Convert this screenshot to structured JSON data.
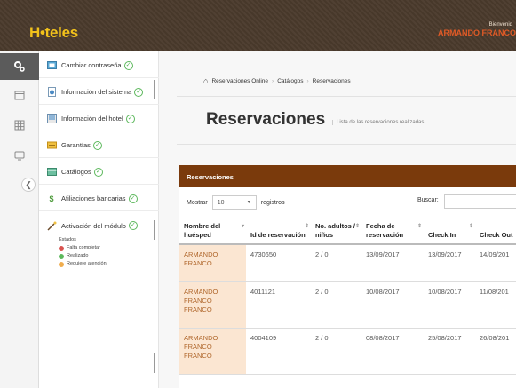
{
  "header": {
    "logo": "H•teles",
    "welcome_label": "Bienvenid",
    "user_name": "ARMANDO FRANCO"
  },
  "menu": {
    "items": [
      {
        "label": "Cambiar contraseña",
        "icon": "key-icon"
      },
      {
        "label": "Información del sistema",
        "icon": "info-icon"
      },
      {
        "label": "Información del hotel",
        "icon": "hotel-icon"
      },
      {
        "label": "Garantías",
        "icon": "garantia-icon"
      },
      {
        "label": "Catálogos",
        "icon": "catalog-icon"
      },
      {
        "label": "Afiliaciones bancarias",
        "icon": "dollar-icon"
      },
      {
        "label": "Activación del módulo",
        "icon": "wand-icon"
      }
    ],
    "legend": {
      "title": "Estados",
      "items": [
        {
          "label": "Falta completar",
          "color": "#d9534f"
        },
        {
          "label": "Realizado",
          "color": "#5cb85c"
        },
        {
          "label": "Requiere atención",
          "color": "#f0ad4e"
        }
      ]
    }
  },
  "breadcrumb": {
    "items": [
      "Reservaciones Online",
      "Catálogos",
      "Reservaciones"
    ]
  },
  "page": {
    "title": "Reservaciones",
    "subtitle": "Lista de las reservaciones realizadas."
  },
  "panel": {
    "title": "Reservaciones",
    "show_label": "Mostrar",
    "show_value": "10",
    "records_label": "registros",
    "search_label": "Buscar:"
  },
  "table": {
    "columns": [
      "Nombre del huésped",
      "Id de reservación",
      "No. adultos / niños",
      "Fecha de reservación",
      "Check In",
      "Check Out"
    ],
    "rows": [
      {
        "guest": "ARMANDO FRANCO",
        "id": "4730650",
        "people": "2 / 0",
        "date": "13/09/2017",
        "checkin": "13/09/2017",
        "checkout": "14/09/201"
      },
      {
        "guest": "ARMANDO FRANCO FRANCO",
        "id": "4011121",
        "people": "2 / 0",
        "date": "10/08/2017",
        "checkin": "10/08/2017",
        "checkout": "11/08/201"
      },
      {
        "guest": "ARMANDO FRANCO FRANCO",
        "id": "4004109",
        "people": "2 / 0",
        "date": "08/08/2017",
        "checkin": "25/08/2017",
        "checkout": "26/08/201"
      }
    ]
  }
}
